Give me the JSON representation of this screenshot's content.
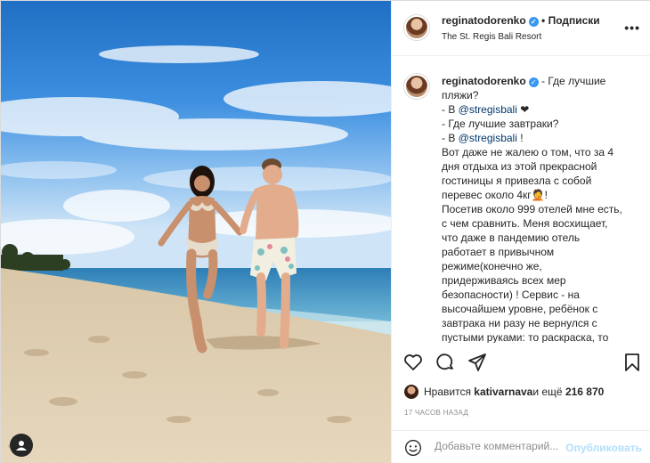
{
  "post": {
    "username": "reginatodorenko",
    "verified_glyph": "✓",
    "follow_label": "Подписки",
    "location": "The St. Regis Bali Resort",
    "more_glyph": "•••",
    "caption_lines": [
      "- Где лучшие",
      "пляжи?",
      "- В ",
      "@stregisbali",
      " ❤",
      "- Где лучшие завтраки?",
      "- В ",
      "@stregisbali",
      " !",
      "Вот даже не жалею о том, что за 4",
      "дня отдыха из этой прекрасной",
      "гостиницы я привезла с собой",
      "перевес около 4кг🤦!",
      "Посетив около 999 отелей мне есть,",
      "с чем сравнить. Меня восхищает,",
      "что даже в пандемию отель",
      "работает в привычном",
      "режиме(конечно же,",
      "придерживаясь всех мер",
      "безопасности) ! Сервис - на",
      "высочайшем уровне, ребёнок с",
      "завтрака ни разу не вернулся с",
      "пустыми руками: то раскраска, то"
    ],
    "likes_prefix": "Нравится ",
    "likes_user": "kativarnava",
    "likes_middle": " и ещё ",
    "likes_count": "216 870",
    "timestamp": "17 ЧАСОВ НАЗАД",
    "comment_placeholder": "Добавьте комментарий...",
    "publish_label": "Опубликовать"
  },
  "icons": {
    "like": "heart-icon",
    "comment": "comment-icon",
    "share": "share-icon",
    "save": "bookmark-icon",
    "emoji": "emoji-icon",
    "tagged": "user-icon"
  },
  "colors": {
    "accent": "#3897f0",
    "mention": "#00376b",
    "publish_disabled": "#b2dffc",
    "muted": "#8e8e8e"
  }
}
